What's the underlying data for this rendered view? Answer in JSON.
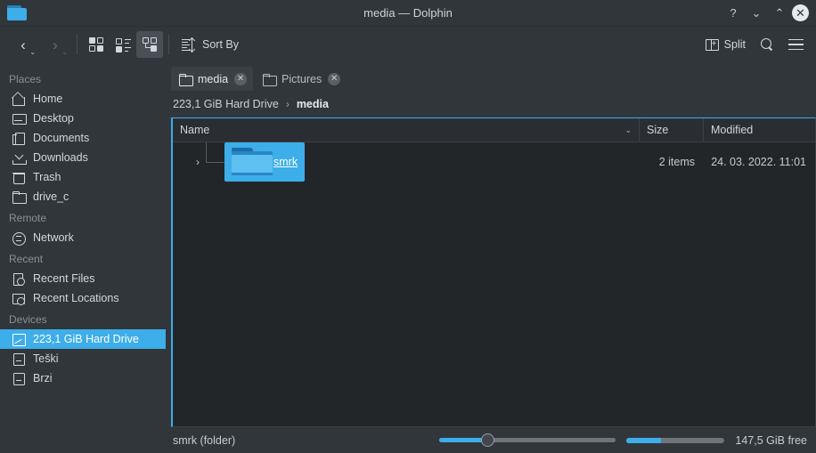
{
  "window": {
    "title": "media — Dolphin",
    "app_icon": "folder-icon",
    "controls": {
      "help": "?",
      "minimize": "⌄",
      "maximize": "⌃",
      "close": "✕"
    }
  },
  "toolbar": {
    "back": {
      "label": "‹",
      "icon": "chevron-left-icon",
      "enabled": true
    },
    "forward": {
      "label": "›",
      "icon": "chevron-right-icon",
      "enabled": false
    },
    "dropdown_arrow": "⌄",
    "view_modes": [
      {
        "name": "icons",
        "icon": "icons-view-icon",
        "active": false
      },
      {
        "name": "compact",
        "icon": "compact-view-icon",
        "active": false
      },
      {
        "name": "details",
        "icon": "details-view-icon",
        "active": true
      }
    ],
    "sort_by_label": "Sort By",
    "sort_by_icon": "sort-icon",
    "split_label": "Split",
    "split_icon": "split-icon",
    "search_icon": "search-icon",
    "menu_icon": "hamburger-menu-icon"
  },
  "tabs": [
    {
      "label": "media",
      "icon": "folder-icon",
      "active": true,
      "close": "✕"
    },
    {
      "label": "Pictures",
      "icon": "folder-icon",
      "active": false,
      "close": "✕"
    }
  ],
  "breadcrumb": {
    "root": "223,1 GiB Hard Drive",
    "separator": "›",
    "current": "media"
  },
  "sidebar": {
    "groups": [
      {
        "title": "Places",
        "items": [
          {
            "label": "Home",
            "icon": "home-icon",
            "selected": false
          },
          {
            "label": "Desktop",
            "icon": "desktop-icon",
            "selected": false
          },
          {
            "label": "Documents",
            "icon": "documents-icon",
            "selected": false
          },
          {
            "label": "Downloads",
            "icon": "downloads-icon",
            "selected": false
          },
          {
            "label": "Trash",
            "icon": "trash-icon",
            "selected": false
          },
          {
            "label": "drive_c",
            "icon": "folder-icon",
            "selected": false
          }
        ]
      },
      {
        "title": "Remote",
        "items": [
          {
            "label": "Network",
            "icon": "network-icon",
            "selected": false
          }
        ]
      },
      {
        "title": "Recent",
        "items": [
          {
            "label": "Recent Files",
            "icon": "recent-files-icon",
            "selected": false
          },
          {
            "label": "Recent Locations",
            "icon": "recent-locations-icon",
            "selected": false
          }
        ]
      },
      {
        "title": "Devices",
        "items": [
          {
            "label": "223,1 GiB Hard Drive",
            "icon": "hard-drive-icon",
            "selected": true
          },
          {
            "label": "Teški",
            "icon": "drive-icon",
            "selected": false
          },
          {
            "label": "Brzi",
            "icon": "drive-icon",
            "selected": false
          }
        ]
      }
    ]
  },
  "file_view": {
    "columns": [
      {
        "key": "name",
        "label": "Name",
        "sort_indicator": "⌄"
      },
      {
        "key": "size",
        "label": "Size"
      },
      {
        "key": "modified",
        "label": "Modified"
      }
    ],
    "rows": [
      {
        "name": "smrk",
        "icon": "folder-icon",
        "size": "2 items",
        "modified": "24. 03. 2022. 11:01",
        "selected": true,
        "expand_arrow": "›"
      }
    ]
  },
  "statusbar": {
    "selection_text": "smrk (folder)",
    "zoom_slider": {
      "value_percent": 27
    },
    "free_space_bar": {
      "used_percent": 35
    },
    "free_space_text": "147,5 GiB free"
  },
  "colors": {
    "accent": "#3daee9",
    "window_bg": "#31363b",
    "view_bg": "#232629",
    "header_bg": "#2a2e33",
    "text": "#d4d7db",
    "muted_text": "#8b9096"
  }
}
